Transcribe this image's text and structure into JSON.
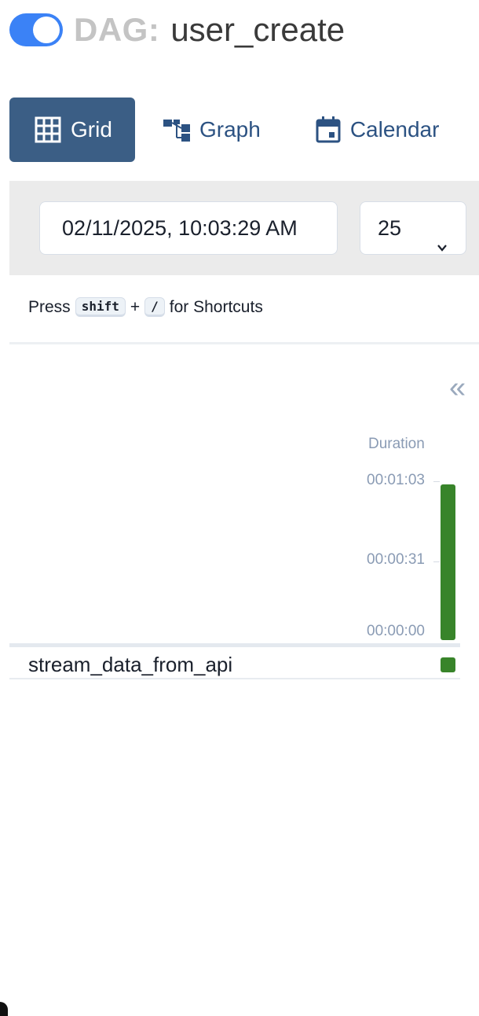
{
  "header": {
    "toggle_on": true,
    "title_prefix": "DAG:",
    "dag_name": "user_create",
    "toggle_color": "#3b82f6"
  },
  "tabs": [
    {
      "label": "Grid",
      "icon": "grid-icon",
      "active": true
    },
    {
      "label": "Graph",
      "icon": "graph-icon",
      "active": false
    },
    {
      "label": "Calendar",
      "icon": "calendar-icon",
      "active": false
    }
  ],
  "filters": {
    "base_date": "02/11/2025, 10:03:29 AM",
    "num_runs": "25"
  },
  "shortcuts": {
    "press": "Press",
    "key1": "shift",
    "plus": "+",
    "key2": "/",
    "suffix": "for Shortcuts"
  },
  "grid": {
    "collapse_icon": "double-chevron-left-icon",
    "duration_label": "Duration",
    "ticks": [
      "00:01:03",
      "00:00:31",
      "00:00:00"
    ],
    "run_duration": "00:01:03",
    "run_status_color": "#38842a",
    "tasks": [
      {
        "name": "stream_data_from_api",
        "status_color": "#38842a"
      }
    ]
  }
}
